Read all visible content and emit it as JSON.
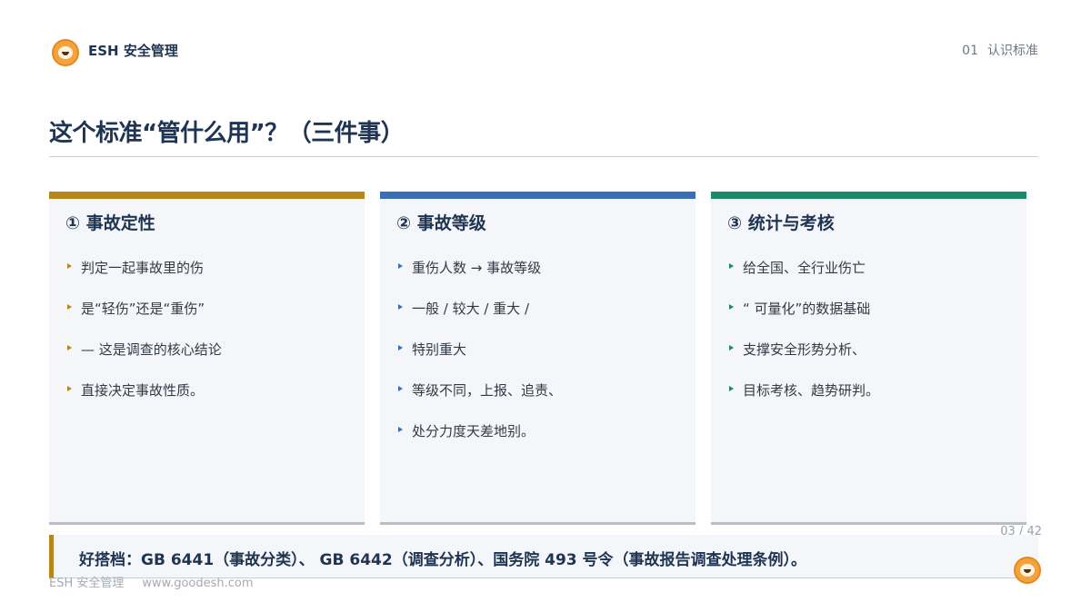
{
  "header": {
    "brand": "ESH  安全管理",
    "section_number": "01",
    "section_label": "认识标准"
  },
  "title": "这个标准“管什么用”？（三件事）",
  "cards": [
    {
      "title": "①  事故定性",
      "accent": "#b8861b",
      "items": [
        "判定一起事故里的伤",
        "是“轻伤”还是“重伤”",
        "— 这是调查的核心结论",
        "直接决定事故性质。"
      ]
    },
    {
      "title": "②  事故等级",
      "accent": "#3a6fb5",
      "items": [
        "重伤人数 → 事故等级",
        "一般   /  较大   /  重大   /",
        "特别重大",
        "等级不同，上报、追责、",
        "处分力度天差地别。"
      ]
    },
    {
      "title": "③  统计与考核",
      "accent": "#1a8a68",
      "items": [
        "给全国、全行业伤亡",
        "“ 可量化”的数据基础",
        "支撑安全形势分析、",
        "目标考核、趋势研判。"
      ]
    }
  ],
  "note": "好搭档：GB 6441（事故分类）、 GB 6442（调查分析）、国务院 493 号令（事故报告调查处理条例）。",
  "page_number": "03 / 42",
  "footer": {
    "brand": "ESH 安全管理",
    "url": "www.goodesh.com"
  },
  "icons": {
    "logo": "tiger-mascot-icon",
    "bullet": "triangle-bullet-icon"
  }
}
